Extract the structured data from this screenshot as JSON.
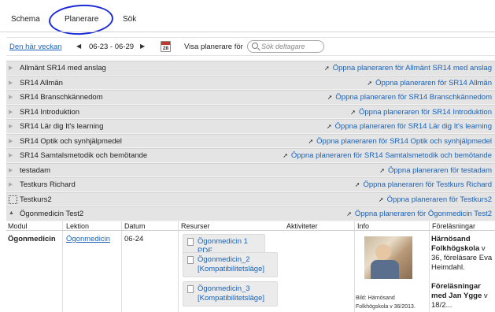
{
  "tabs": {
    "schema": "Schema",
    "planerare": "Planerare",
    "sok": "Sök"
  },
  "toolbar": {
    "this_week": "Den här veckan",
    "date_range": "06-23 - 06-29",
    "calendar_day": "28",
    "show_for": "Visa planerare för",
    "search_placeholder": "Sök deltagare"
  },
  "planners": [
    {
      "name": "Allmänt SR14 med anslag",
      "open": "Öppna planeraren för Allmänt SR14 med anslag"
    },
    {
      "name": "SR14 Allmän",
      "open": "Öppna planeraren för SR14 Allmän"
    },
    {
      "name": "SR14 Branschkännedom",
      "open": "Öppna planeraren för SR14 Branschkännedom"
    },
    {
      "name": "SR14 Introduktion",
      "open": "Öppna planeraren för SR14 Introduktion"
    },
    {
      "name": "SR14 Lär dig It's learning",
      "open": "Öppna planeraren för SR14 Lär dig It's learning"
    },
    {
      "name": "SR14 Optik och synhjälpmedel",
      "open": "Öppna planeraren för SR14 Optik och synhjälpmedel"
    },
    {
      "name": "SR14 Samtalsmetodik och bemötande",
      "open": "Öppna planeraren för SR14 Samtalsmetodik och bemötande"
    },
    {
      "name": "testadam",
      "open": "Öppna planeraren för testadam"
    },
    {
      "name": "Testkurs Richard",
      "open": "Öppna planeraren för Testkurs Richard"
    },
    {
      "name": "Testkurs2",
      "open": "Öppna planeraren för Testkurs2"
    },
    {
      "name": "Ögonmedicin Test2",
      "open": "Öppna planeraren för Ögonmedicin Test2"
    }
  ],
  "table": {
    "headers": [
      "Modul",
      "Lektion",
      "Datum",
      "Resurser",
      "Aktiviteter",
      "Info",
      "Föreläsningar"
    ],
    "row": {
      "modul": "Ögonmedicin",
      "lektion": "Ögonmedicin",
      "datum": "06-24",
      "resources": [
        "Ögonmedicin 1 PDF",
        "Ögonmedicin_2 [Kompatibilitetsläge]",
        "Ögonmedicin_3 [Kompatibilitetsläge]"
      ],
      "info_caption_1": "Bild: Härnösand",
      "info_caption_2": "Folkhögskola v 36/2013.",
      "lecture_1_bold": "Härnösand Folkhögskola",
      "lecture_1_rest": " v 36, föreläsare Eva Heimdahl.",
      "lecture_2_bold": "Föreläsningar med Jan Ygge",
      "lecture_2_rest": " v 18/2..."
    }
  }
}
